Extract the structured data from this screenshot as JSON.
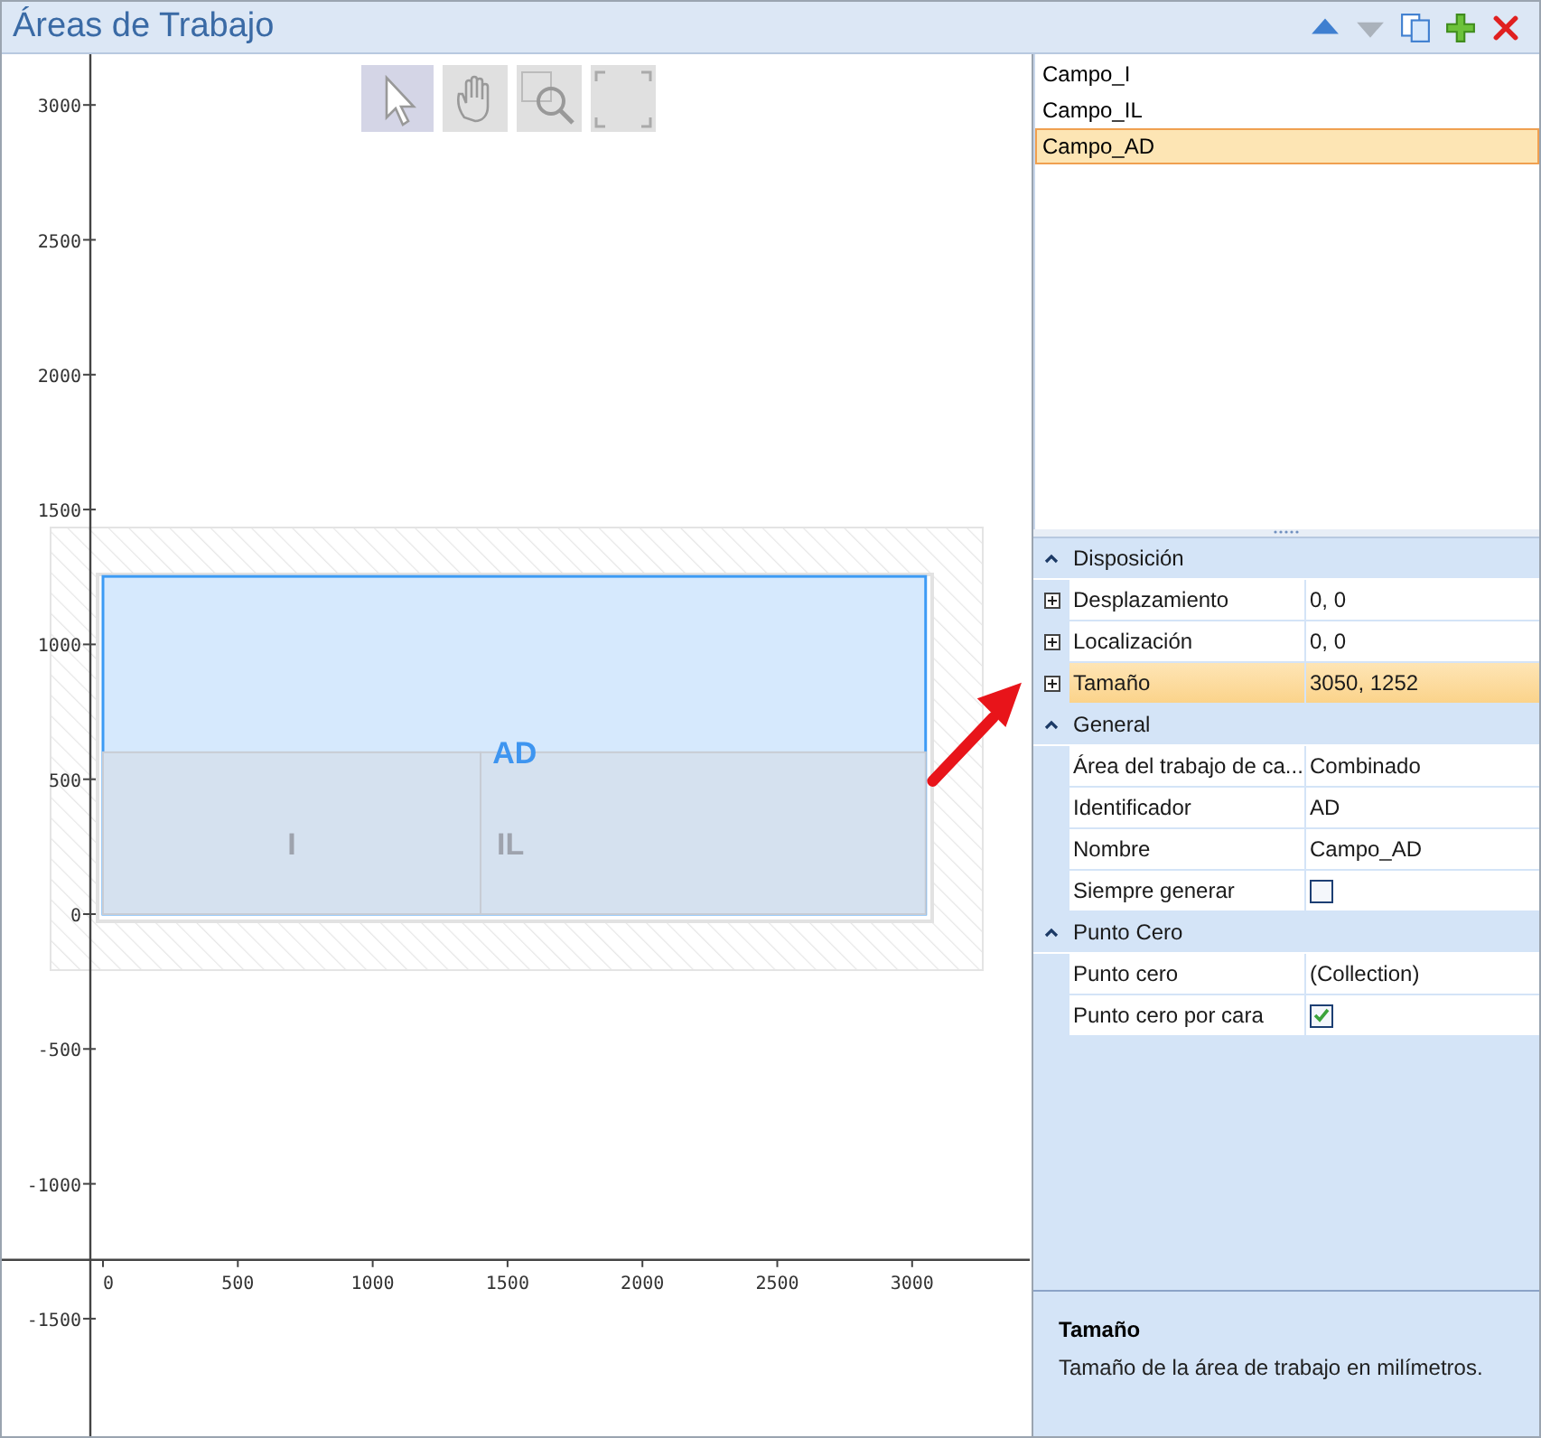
{
  "window": {
    "title": "Áreas de Trabajo"
  },
  "toolbar": [
    {
      "kind": "up",
      "disabled": false
    },
    {
      "kind": "down",
      "disabled": true
    },
    {
      "kind": "copy",
      "disabled": false
    },
    {
      "kind": "add",
      "disabled": false
    },
    {
      "kind": "delete",
      "disabled": false
    }
  ],
  "canvas_tools": [
    {
      "kind": "pointer",
      "selected": true
    },
    {
      "kind": "hand",
      "selected": false
    },
    {
      "kind": "zoom",
      "selected": false
    },
    {
      "kind": "fit",
      "selected": false
    }
  ],
  "canvas": {
    "y_ticks": [
      "3000",
      "2500",
      "2000",
      "1500",
      "1000",
      "500",
      "0",
      "-500",
      "-1000",
      "-1500"
    ],
    "x_ticks": [
      "0",
      "500",
      "1000",
      "1500",
      "2000",
      "2500",
      "3000"
    ],
    "areas": [
      {
        "label": "AD",
        "selected": true
      },
      {
        "label": "I",
        "selected": false
      },
      {
        "label": "IL",
        "selected": false
      }
    ]
  },
  "areas_list": [
    {
      "label": "Campo_I",
      "selected": false
    },
    {
      "label": "Campo_IL",
      "selected": false
    },
    {
      "label": "Campo_AD",
      "selected": true
    }
  ],
  "properties": [
    {
      "category": "Disposición",
      "expanded": true,
      "rows": [
        {
          "name": "Desplazamiento",
          "value": "0, 0",
          "kind": "text",
          "expandable": true,
          "selected": false
        },
        {
          "name": "Localización",
          "value": "0, 0",
          "kind": "text",
          "expandable": true,
          "selected": false
        },
        {
          "name": "Tamaño",
          "value": "3050, 1252",
          "kind": "text",
          "expandable": true,
          "selected": true
        }
      ]
    },
    {
      "category": "General",
      "expanded": true,
      "rows": [
        {
          "name": "Área del trabajo de ca...",
          "value": "Combinado",
          "kind": "text",
          "expandable": false,
          "selected": false
        },
        {
          "name": "Identificador",
          "value": "AD",
          "kind": "text",
          "expandable": false,
          "selected": false
        },
        {
          "name": "Nombre",
          "value": "Campo_AD",
          "kind": "text",
          "expandable": false,
          "selected": false
        },
        {
          "name": "Siempre generar",
          "checked": false,
          "kind": "checkbox",
          "expandable": false,
          "selected": false
        }
      ]
    },
    {
      "category": "Punto Cero",
      "expanded": true,
      "rows": [
        {
          "name": "Punto cero",
          "value": "(Collection)",
          "kind": "text",
          "expandable": false,
          "selected": false
        },
        {
          "name": "Punto cero por cara",
          "checked": true,
          "kind": "checkbox",
          "expandable": false,
          "selected": false
        }
      ]
    }
  ],
  "description": {
    "title": "Tamaño",
    "text": "Tamaño de la área de trabajo en milímetros."
  }
}
